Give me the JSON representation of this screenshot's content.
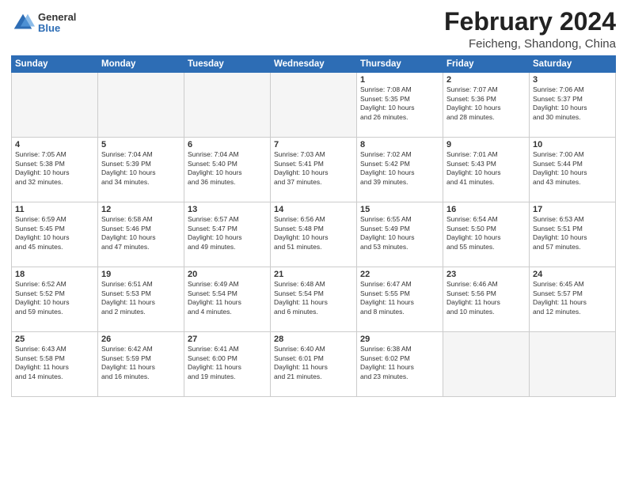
{
  "header": {
    "logo_general": "General",
    "logo_blue": "Blue",
    "month_title": "February 2024",
    "location": "Feicheng, Shandong, China"
  },
  "days_of_week": [
    "Sunday",
    "Monday",
    "Tuesday",
    "Wednesday",
    "Thursday",
    "Friday",
    "Saturday"
  ],
  "weeks": [
    [
      {
        "day": "",
        "info": ""
      },
      {
        "day": "",
        "info": ""
      },
      {
        "day": "",
        "info": ""
      },
      {
        "day": "",
        "info": ""
      },
      {
        "day": "1",
        "info": "Sunrise: 7:08 AM\nSunset: 5:35 PM\nDaylight: 10 hours\nand 26 minutes."
      },
      {
        "day": "2",
        "info": "Sunrise: 7:07 AM\nSunset: 5:36 PM\nDaylight: 10 hours\nand 28 minutes."
      },
      {
        "day": "3",
        "info": "Sunrise: 7:06 AM\nSunset: 5:37 PM\nDaylight: 10 hours\nand 30 minutes."
      }
    ],
    [
      {
        "day": "4",
        "info": "Sunrise: 7:05 AM\nSunset: 5:38 PM\nDaylight: 10 hours\nand 32 minutes."
      },
      {
        "day": "5",
        "info": "Sunrise: 7:04 AM\nSunset: 5:39 PM\nDaylight: 10 hours\nand 34 minutes."
      },
      {
        "day": "6",
        "info": "Sunrise: 7:04 AM\nSunset: 5:40 PM\nDaylight: 10 hours\nand 36 minutes."
      },
      {
        "day": "7",
        "info": "Sunrise: 7:03 AM\nSunset: 5:41 PM\nDaylight: 10 hours\nand 37 minutes."
      },
      {
        "day": "8",
        "info": "Sunrise: 7:02 AM\nSunset: 5:42 PM\nDaylight: 10 hours\nand 39 minutes."
      },
      {
        "day": "9",
        "info": "Sunrise: 7:01 AM\nSunset: 5:43 PM\nDaylight: 10 hours\nand 41 minutes."
      },
      {
        "day": "10",
        "info": "Sunrise: 7:00 AM\nSunset: 5:44 PM\nDaylight: 10 hours\nand 43 minutes."
      }
    ],
    [
      {
        "day": "11",
        "info": "Sunrise: 6:59 AM\nSunset: 5:45 PM\nDaylight: 10 hours\nand 45 minutes."
      },
      {
        "day": "12",
        "info": "Sunrise: 6:58 AM\nSunset: 5:46 PM\nDaylight: 10 hours\nand 47 minutes."
      },
      {
        "day": "13",
        "info": "Sunrise: 6:57 AM\nSunset: 5:47 PM\nDaylight: 10 hours\nand 49 minutes."
      },
      {
        "day": "14",
        "info": "Sunrise: 6:56 AM\nSunset: 5:48 PM\nDaylight: 10 hours\nand 51 minutes."
      },
      {
        "day": "15",
        "info": "Sunrise: 6:55 AM\nSunset: 5:49 PM\nDaylight: 10 hours\nand 53 minutes."
      },
      {
        "day": "16",
        "info": "Sunrise: 6:54 AM\nSunset: 5:50 PM\nDaylight: 10 hours\nand 55 minutes."
      },
      {
        "day": "17",
        "info": "Sunrise: 6:53 AM\nSunset: 5:51 PM\nDaylight: 10 hours\nand 57 minutes."
      }
    ],
    [
      {
        "day": "18",
        "info": "Sunrise: 6:52 AM\nSunset: 5:52 PM\nDaylight: 10 hours\nand 59 minutes."
      },
      {
        "day": "19",
        "info": "Sunrise: 6:51 AM\nSunset: 5:53 PM\nDaylight: 11 hours\nand 2 minutes."
      },
      {
        "day": "20",
        "info": "Sunrise: 6:49 AM\nSunset: 5:54 PM\nDaylight: 11 hours\nand 4 minutes."
      },
      {
        "day": "21",
        "info": "Sunrise: 6:48 AM\nSunset: 5:54 PM\nDaylight: 11 hours\nand 6 minutes."
      },
      {
        "day": "22",
        "info": "Sunrise: 6:47 AM\nSunset: 5:55 PM\nDaylight: 11 hours\nand 8 minutes."
      },
      {
        "day": "23",
        "info": "Sunrise: 6:46 AM\nSunset: 5:56 PM\nDaylight: 11 hours\nand 10 minutes."
      },
      {
        "day": "24",
        "info": "Sunrise: 6:45 AM\nSunset: 5:57 PM\nDaylight: 11 hours\nand 12 minutes."
      }
    ],
    [
      {
        "day": "25",
        "info": "Sunrise: 6:43 AM\nSunset: 5:58 PM\nDaylight: 11 hours\nand 14 minutes."
      },
      {
        "day": "26",
        "info": "Sunrise: 6:42 AM\nSunset: 5:59 PM\nDaylight: 11 hours\nand 16 minutes."
      },
      {
        "day": "27",
        "info": "Sunrise: 6:41 AM\nSunset: 6:00 PM\nDaylight: 11 hours\nand 19 minutes."
      },
      {
        "day": "28",
        "info": "Sunrise: 6:40 AM\nSunset: 6:01 PM\nDaylight: 11 hours\nand 21 minutes."
      },
      {
        "day": "29",
        "info": "Sunrise: 6:38 AM\nSunset: 6:02 PM\nDaylight: 11 hours\nand 23 minutes."
      },
      {
        "day": "",
        "info": ""
      },
      {
        "day": "",
        "info": ""
      }
    ]
  ]
}
